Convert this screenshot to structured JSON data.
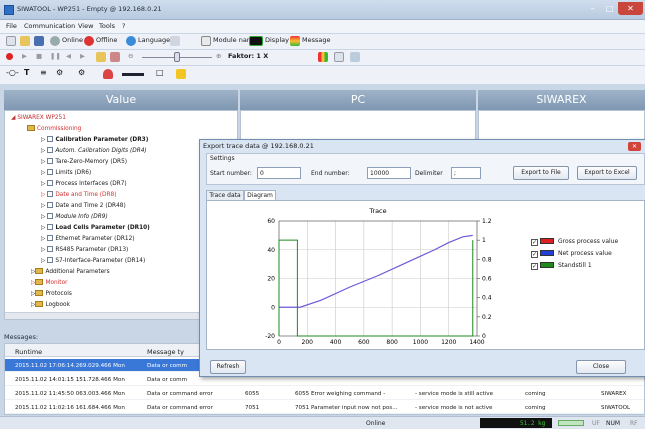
{
  "window": {
    "title": "SIWATOOL - WP251 - Empty @ 192.168.0.21"
  },
  "menu": [
    "File",
    "Communication",
    "View",
    "Tools",
    "?"
  ],
  "toolbar1": {
    "online": "Online",
    "offline": "Offline",
    "language": "Language -",
    "module_name": "Module name",
    "display": "Display",
    "message": "Message"
  },
  "toolbar2": {
    "faktor": "Faktor: 1 X"
  },
  "columns": {
    "value": "Value",
    "pc": "PC",
    "siwarex": "SIWAREX"
  },
  "tree": {
    "root": "SIWAREX WP251",
    "commissioning": "Commissioning",
    "items": [
      "Calibration Parameter (DR3)",
      "Autom. Calibration Digits (DR4)",
      "Tare-Zero-Memory (DR5)",
      "Limits (DR6)",
      "Process Interfaces (DR7)",
      "Date and Time (DR8)",
      "Date and Time 2 (DR48)",
      "Module Info (DR9)",
      "Load Cells Parameter (DR10)",
      "Ethernet Parameter (DR12)",
      "RS485 Parameter (DR13)",
      "S7-Interface-Parameter (DR14)"
    ],
    "groups": [
      "Additional Parameters",
      "Monitor",
      "Protocols",
      "Logbook"
    ]
  },
  "messages": {
    "label": "Messages:",
    "headers": [
      "Runtime",
      "Message ty"
    ],
    "rows": [
      [
        "2015.11.02 17:06:14.269.029.466 Mon",
        "Data or comm",
        "",
        "",
        "",
        "",
        ""
      ],
      [
        "2015.11.02 14:01:15 151.728.466 Mon",
        "Data or comm",
        "",
        "",
        "",
        "",
        ""
      ],
      [
        "2015.11.02 11:45:50 063.003.466 Mon",
        "Data or command error",
        "6055",
        "6055 Error weighing command -",
        "- service mode is still active",
        "coming",
        "SIWAREX"
      ],
      [
        "2015.11.02 11:02:16 161.684.466 Mon",
        "Data or command error",
        "7051",
        "7051 Parameter input now not pos...",
        "- service mode is not active",
        "coming",
        "SIWATOOL"
      ]
    ]
  },
  "status": {
    "mode": "Online",
    "weight": "51.2 kg",
    "uf": "UF",
    "num": "NUM",
    "rf": "RF"
  },
  "dialog": {
    "title": "Export trace data @ 192.168.0.21",
    "settings_label": "Settings",
    "start_label": "Start number:",
    "start_value": "0",
    "end_label": "End number:",
    "end_value": "10000",
    "delim_label": "Delimiter",
    "delim_value": ";",
    "export_file": "Export to File",
    "export_excel": "Export to Excel",
    "tabs": [
      "Trace data",
      "Diagram"
    ],
    "refresh": "Refresh",
    "close": "Close"
  },
  "colors": {
    "gross": "#e02020",
    "net": "#1f3fd8",
    "standstill": "#1e8a1e",
    "trace": "#6a5ad8"
  },
  "chart_data": {
    "type": "line",
    "title": "Trace",
    "xlim": [
      0,
      1400
    ],
    "x_ticks": [
      "0",
      "200",
      "400",
      "600",
      "800",
      "1000",
      "1200",
      "1400"
    ],
    "ylim": [
      -20,
      60
    ],
    "y_ticks": [
      "60",
      "40",
      "20",
      "0",
      "-20"
    ],
    "y2lim": [
      0,
      1.2
    ],
    "y2_ticks": [
      "1.2",
      "1",
      "0.8",
      "0.6",
      "0.4",
      "0.2",
      "0"
    ],
    "legend": [
      "Gross process value",
      "Net process value",
      "Standstill 1"
    ],
    "series": [
      {
        "name": "Gross process value",
        "x": [
          0,
          130,
          150,
          300,
          500,
          700,
          900,
          1100,
          1200,
          1300,
          1370
        ],
        "y": [
          0,
          0,
          0,
          5,
          14,
          22,
          31,
          40,
          45,
          49,
          50
        ]
      },
      {
        "name": "Standstill 1",
        "x": [
          0,
          0,
          130,
          130,
          1370,
          1370
        ],
        "y2": [
          0,
          1,
          1,
          0,
          0,
          1
        ]
      }
    ]
  }
}
